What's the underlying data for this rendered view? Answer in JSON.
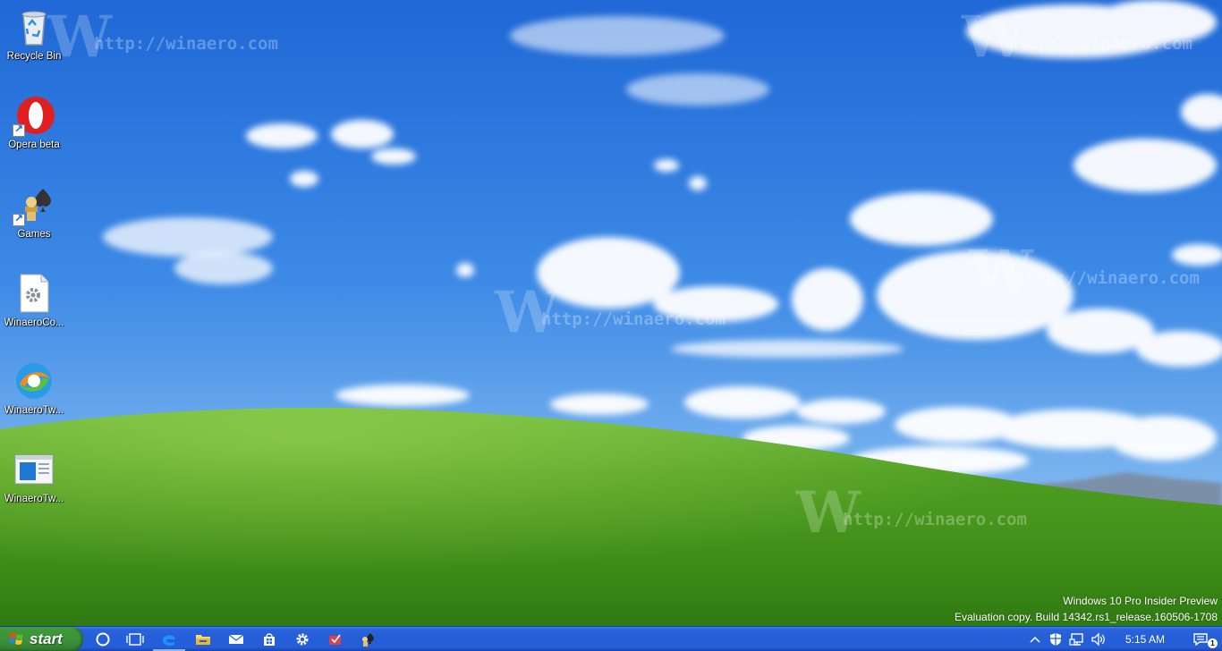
{
  "desktop": {
    "watermark_text": "http://winaero.com",
    "watermark_logo": "W",
    "icons": [
      {
        "label": "Recycle Bin",
        "icon": "recycle-bin-icon"
      },
      {
        "label": "Opera beta",
        "icon": "opera-icon"
      },
      {
        "label": "Games",
        "icon": "games-icon"
      },
      {
        "label": "WinaeroCo...",
        "icon": "gear-file-icon"
      },
      {
        "label": "WinaeroTw...",
        "icon": "winaero-tweaker-icon"
      },
      {
        "label": "WinaeroTw...",
        "icon": "window-icon"
      }
    ],
    "eval_line1": "Windows 10 Pro Insider Preview",
    "eval_line2": "Evaluation copy. Build 14342.rs1_release.160506-1708"
  },
  "taskbar": {
    "start_label": "start",
    "pinned": [
      {
        "name": "cortana-icon"
      },
      {
        "name": "task-view-icon"
      },
      {
        "name": "edge-icon"
      },
      {
        "name": "file-explorer-icon"
      },
      {
        "name": "mail-icon"
      },
      {
        "name": "store-icon"
      },
      {
        "name": "settings-gear-icon"
      },
      {
        "name": "app-icon"
      },
      {
        "name": "games-icon"
      }
    ],
    "tray": {
      "clock": "5:15 AM",
      "notification_count": "1",
      "icons": [
        "chevron-up-icon",
        "shield-icon",
        "network-icon",
        "volume-icon"
      ]
    },
    "colors": {
      "taskbar": "#245ed8",
      "start": "#3c8f3b"
    }
  }
}
